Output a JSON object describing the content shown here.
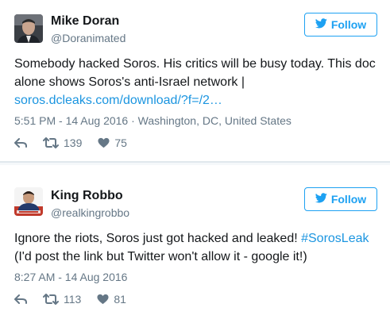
{
  "tweets": [
    {
      "display_name": "Mike Doran",
      "handle": "@Doranimated",
      "follow_label": "Follow",
      "text_before": "Somebody hacked Soros. His critics will be busy today. This doc alone shows Soros's anti-Israel network | ",
      "link": "soros.dcleaks.com/download/?f=/2…",
      "timestamp": "5:51 PM - 14 Aug 2016 · Washington, DC, United States",
      "retweets": "139",
      "likes": "75"
    },
    {
      "display_name": "King Robbo",
      "handle": "@realkingrobbo",
      "follow_label": "Follow",
      "text_before": "Ignore the riots, Soros just got hacked and leaked! ",
      "hashtag": "#SorosLeak",
      "text_after": " (I'd post the link but Twitter won't allow it - google it!)",
      "timestamp": "8:27 AM - 14 Aug 2016",
      "retweets": "113",
      "likes": "81"
    }
  ],
  "colors": {
    "accent": "#1da1f2",
    "link": "#1b95e0",
    "secondary_text": "#657786",
    "primary_text": "#14171a"
  },
  "icons": [
    "twitter-bird-icon",
    "reply-icon",
    "retweet-icon",
    "heart-icon"
  ]
}
